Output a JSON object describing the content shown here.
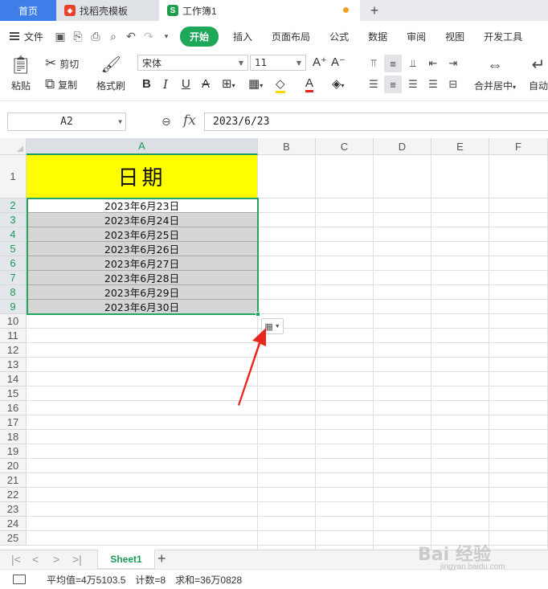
{
  "tabs": {
    "home_label": "首页",
    "templates_label": "找稻壳模板",
    "workbook_label": "工作簿1",
    "add_label": "+"
  },
  "menu": {
    "file_label": "文件",
    "items": [
      "开始",
      "插入",
      "页面布局",
      "公式",
      "数据",
      "审阅",
      "视图",
      "开发工具"
    ]
  },
  "ribbon": {
    "paste_label": "粘贴",
    "cut_label": "剪切",
    "copy_label": "复制",
    "format_painter_label": "格式刷",
    "font_name": "宋体",
    "font_size": "11",
    "merge_center_label": "合并居中",
    "auto_wrap_label": "自动"
  },
  "formula_bar": {
    "cell_ref": "A2",
    "fx_label": "fx",
    "value": "2023/6/23"
  },
  "grid": {
    "columns": [
      "A",
      "B",
      "C",
      "D",
      "E",
      "F"
    ],
    "rows": [
      "1",
      "2",
      "3",
      "4",
      "5",
      "6",
      "7",
      "8",
      "9",
      "10",
      "11",
      "12",
      "13",
      "14",
      "15",
      "16",
      "17",
      "18",
      "19",
      "20",
      "21",
      "22",
      "23",
      "24",
      "25"
    ],
    "header_cell": "日期",
    "dates": [
      "2023年6月23日",
      "2023年6月24日",
      "2023年6月25日",
      "2023年6月26日",
      "2023年6月27日",
      "2023年6月28日",
      "2023年6月29日",
      "2023年6月30日"
    ]
  },
  "sheet": {
    "name": "Sheet1",
    "add_label": "+"
  },
  "status": {
    "average": "平均值=4万5103.5",
    "count": "计数=8",
    "sum": "求和=36万0828"
  },
  "watermark": {
    "text": "Bai 经验",
    "sub": "jingyan.baidu.com"
  },
  "colors": {
    "accent_green": "#1ea95a",
    "home_tab_blue": "#3d7ee8",
    "header_yellow": "#ffff00",
    "annotation_red": "#e8261e"
  }
}
